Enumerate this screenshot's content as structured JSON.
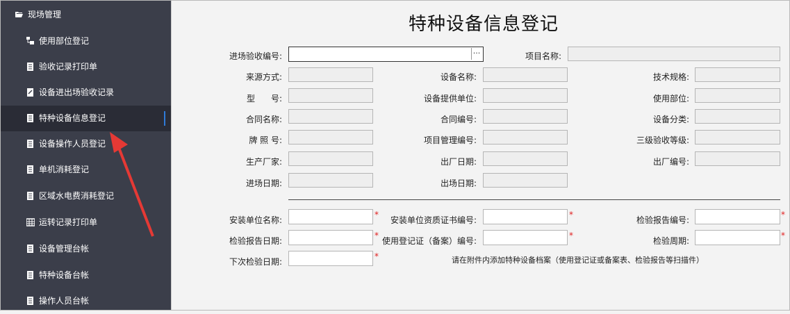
{
  "sidebar": {
    "header": "现场管理",
    "items": [
      {
        "label": "使用部位登记",
        "icon": "sitemap-icon"
      },
      {
        "label": "验收记录打印单",
        "icon": "document-icon"
      },
      {
        "label": "设备进出场验收记录",
        "icon": "edit-document-icon"
      },
      {
        "label": "特种设备信息登记",
        "icon": "document-icon",
        "active": true
      },
      {
        "label": "设备操作人员登记",
        "icon": "document-icon"
      },
      {
        "label": "单机消耗登记",
        "icon": "document-icon"
      },
      {
        "label": "区域水电费消耗登记",
        "icon": "document-icon"
      },
      {
        "label": "运转记录打印单",
        "icon": "table-icon"
      },
      {
        "label": "设备管理台帐",
        "icon": "document-icon"
      },
      {
        "label": "特种设备台帐",
        "icon": "document-icon"
      },
      {
        "label": "操作人员台帐",
        "icon": "document-icon"
      }
    ]
  },
  "form": {
    "title": "特种设备信息登记",
    "fields": {
      "entry_no": {
        "label": "进场验收编号:",
        "value": "",
        "button": "···"
      },
      "project_name": {
        "label": "项目名称:",
        "value": ""
      },
      "source": {
        "label": "来源方式:",
        "value": ""
      },
      "device_name": {
        "label": "设备名称:",
        "value": ""
      },
      "spec": {
        "label": "技术规格:",
        "value": ""
      },
      "model_a": {
        "label": "型",
        "value": ""
      },
      "model_b": {
        "label": "号:"
      },
      "supplier": {
        "label": "设备提供单位:",
        "value": ""
      },
      "use_dept": {
        "label": "使用部位:",
        "value": ""
      },
      "contract_name": {
        "label": "合同名称:",
        "value": ""
      },
      "contract_no": {
        "label": "合同编号:",
        "value": ""
      },
      "category": {
        "label": "设备分类:",
        "value": ""
      },
      "plate_no": {
        "label": "牌 照 号:",
        "value": ""
      },
      "pm_no": {
        "label": "项目管理编号:",
        "value": ""
      },
      "level3": {
        "label": "三级验收等级:",
        "value": ""
      },
      "manufacturer": {
        "label": "生产厂家:",
        "value": ""
      },
      "mfg_date": {
        "label": "出厂日期:",
        "value": ""
      },
      "mfg_no": {
        "label": "出厂编号:",
        "value": ""
      },
      "entry_date": {
        "label": "进场日期:",
        "value": ""
      },
      "exit_date": {
        "label": "出场日期:",
        "value": ""
      },
      "install_unit": {
        "label": "安装单位名称:",
        "value": ""
      },
      "install_cert": {
        "label": "安装单位资质证书编号:",
        "value": ""
      },
      "report_no": {
        "label": "检验报告编号:",
        "value": ""
      },
      "report_date": {
        "label": "检验报告日期:",
        "value": ""
      },
      "reg_cert": {
        "label": "使用登记证（备案）编号:",
        "value": ""
      },
      "inspect_cycle": {
        "label": "检验周期:",
        "value": ""
      },
      "next_inspect": {
        "label": "下次检验日期:",
        "value": ""
      }
    },
    "required_mark": "*",
    "note": "请在附件内添加特种设备档案（使用登记证或备案表、检验报告等扫描件）"
  },
  "colors": {
    "sidebar_bg": "#3b3e4a",
    "active_bg": "#2a2c36",
    "accent": "#2f7ad8",
    "required": "#e02020",
    "arrow": "#e53935"
  }
}
